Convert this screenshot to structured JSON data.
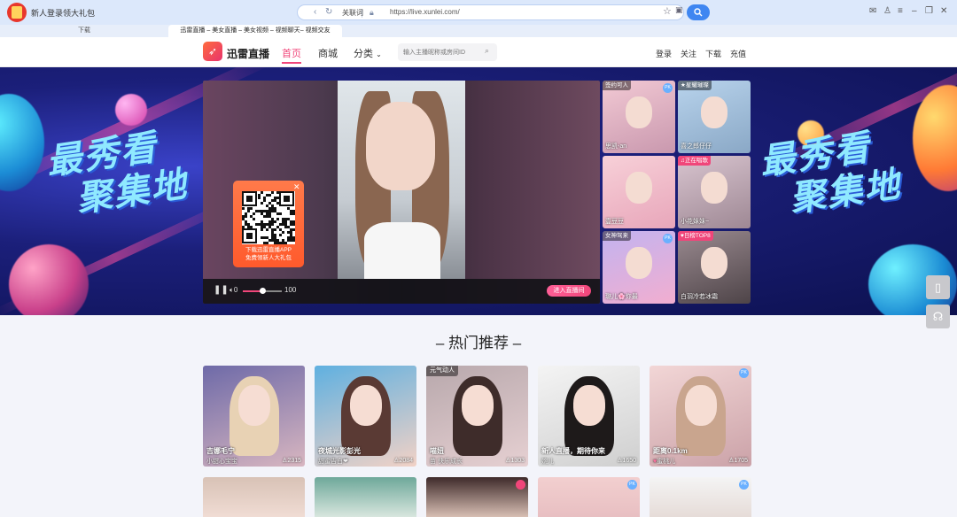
{
  "browser": {
    "promo_text": "新人登录领大礼包",
    "address_label": "关联词",
    "url": "https://live.xunlei.com/",
    "tabs": [
      {
        "label": "下载"
      },
      {
        "label": "迅雷直播 – 美女直播 – 美女视频 – 视频聊天– 视频交友"
      }
    ]
  },
  "header": {
    "brand": "迅雷直播",
    "nav": [
      {
        "label": "首页"
      },
      {
        "label": "商城"
      },
      {
        "label": "分类"
      }
    ],
    "search_placeholder": "输入主播昵称或房间ID",
    "right_links": [
      "登录",
      "关注",
      "下载",
      "充值"
    ]
  },
  "hero": {
    "slogan_line1": "最秀看",
    "slogan_line2": "聚集地",
    "qr_text_line1": "下载迅雷直播APP",
    "qr_text_line2": "免费领新人大礼包",
    "volume_min": "0",
    "volume_max": "100",
    "volume_level": 0.5,
    "enter_button": "进入直播间",
    "side_cards": [
      {
        "tag": "签约可人",
        "name": "思凯-an",
        "pk": true
      },
      {
        "tag": "星耀璀璨",
        "name": "喜之郎仔仔",
        "pk": false
      },
      {
        "tag": "",
        "name": "壹豆豆",
        "pk": false
      },
      {
        "tag": "正在唱歌",
        "name": "小花妹妹~",
        "pk": false
      },
      {
        "tag": "女神驾来",
        "name": "璐儿🌸你最",
        "pk": true
      },
      {
        "tag": "日榜TOP8",
        "name": "白羽冷若冰霜",
        "pk": false
      }
    ]
  },
  "section": {
    "title": "– 热门推荐 –"
  },
  "cards": [
    {
      "tag": "",
      "title": "吉娜毛宁",
      "subtitle": "小甜心宝宝",
      "views": "2315",
      "pk": false
    },
    {
      "tag": "",
      "title": "夜城光影彭光",
      "subtitle": "甜蜜告白❤",
      "views": "2084",
      "pk": false
    },
    {
      "tag": "元气动人",
      "title": "喵妞",
      "subtitle": "苗 快乐成长",
      "views": "1303",
      "pk": false
    },
    {
      "tag": "",
      "title": "新人直播，期待你来",
      "subtitle": "婉儿",
      "views": "1650",
      "pk": false
    },
    {
      "tag": "",
      "title": "距离0.1km",
      "subtitle": "蜜桃儿",
      "views": "1705",
      "pk": true
    }
  ],
  "floating": {
    "phone_icon": "phone-icon",
    "support_icon": "headset-icon"
  }
}
